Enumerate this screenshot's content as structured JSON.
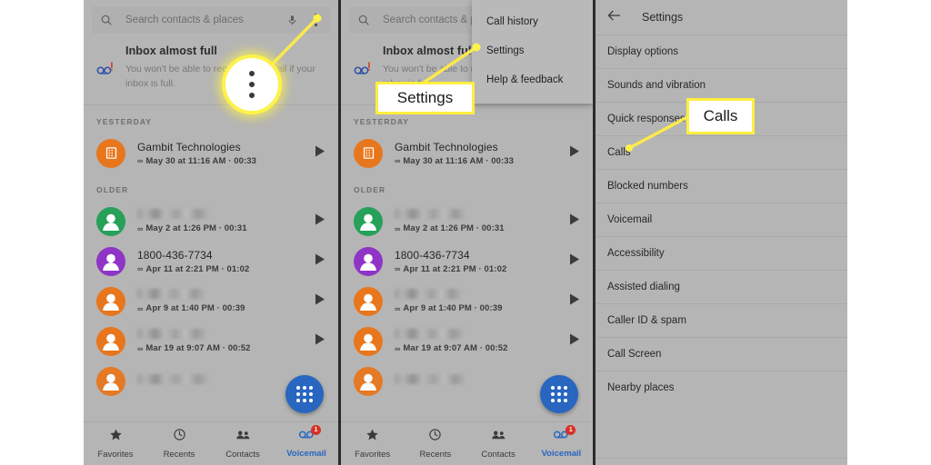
{
  "meta": {
    "background": "#ffffff",
    "panel_bg": "#b5b5b5",
    "accent_blue": "#2866c0",
    "highlight_yellow": "#fdf24a",
    "badge_red": "#d93025"
  },
  "search": {
    "placeholder": "Search contacts & places",
    "search_icon": "search-icon",
    "mic_icon": "microphone-icon",
    "overflow_icon": "more-options-kebab-icon"
  },
  "notification": {
    "icon": "voicemail-alert-icon",
    "title": "Inbox almost full",
    "text": "You won't be able to receive voicemail if your inbox is full."
  },
  "sections": [
    {
      "header": "YESTERDAY",
      "items": [
        {
          "avatar_color": "#e8761d",
          "avatar_icon": "building-icon",
          "title": "Gambit Technologies",
          "title_blurred": false,
          "subtitle": "May 30 at 11:16 AM · 00:33",
          "sub_icon": "voicemail-icon",
          "action_icon": "play-icon"
        }
      ]
    },
    {
      "header": "OLDER",
      "items": [
        {
          "avatar_color": "#27a05a",
          "avatar_icon": "person-icon",
          "title": "",
          "title_blurred": true,
          "subtitle": "May 2 at 1:26 PM · 00:31",
          "sub_icon": "voicemail-icon",
          "action_icon": "play-icon"
        },
        {
          "avatar_color": "#8e35c6",
          "avatar_icon": "person-icon",
          "title": "1800-436-7734",
          "title_blurred": false,
          "subtitle": "Apr 11 at 2:21 PM · 01:02",
          "sub_icon": "voicemail-icon",
          "action_icon": "play-icon"
        },
        {
          "avatar_color": "#e8761d",
          "avatar_icon": "person-icon",
          "title": "",
          "title_blurred": true,
          "subtitle": "Apr 9 at 1:40 PM · 00:39",
          "sub_icon": "voicemail-icon",
          "action_icon": "play-icon"
        },
        {
          "avatar_color": "#e8761d",
          "avatar_icon": "person-icon",
          "title": "",
          "title_blurred": true,
          "subtitle": "Mar 19 at 9:07 AM · 00:52",
          "sub_icon": "voicemail-icon",
          "action_icon": "play-icon"
        }
      ]
    }
  ],
  "fab": {
    "icon": "dialpad-icon"
  },
  "bottom_nav": {
    "items": [
      {
        "label": "Favorites",
        "icon": "star-icon",
        "active": false,
        "badge": ""
      },
      {
        "label": "Recents",
        "icon": "clock-icon",
        "active": false,
        "badge": ""
      },
      {
        "label": "Contacts",
        "icon": "people-icon",
        "active": false,
        "badge": ""
      },
      {
        "label": "Voicemail",
        "icon": "voicemail-icon",
        "active": true,
        "badge": "1"
      }
    ]
  },
  "overflow_menu": {
    "items": [
      "Call history",
      "Settings",
      "Help & feedback"
    ]
  },
  "settings": {
    "back_icon": "back-arrow-icon",
    "title": "Settings",
    "items": [
      "Display options",
      "Sounds and vibration",
      "Quick responses",
      "Calls",
      "Blocked numbers",
      "Voicemail",
      "Accessibility",
      "Assisted dialing",
      "Caller ID & spam",
      "Call Screen",
      "Nearby places"
    ]
  },
  "callouts": {
    "panel1_magnifier_label": "more-options-kebab-zoomed",
    "panel2_box": "Settings",
    "panel3_box": "Calls"
  }
}
